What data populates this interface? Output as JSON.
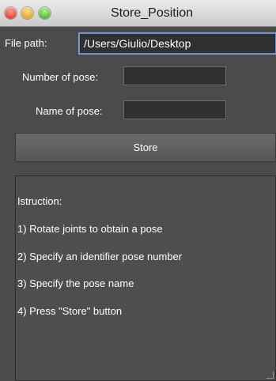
{
  "window": {
    "title": "Store_Position"
  },
  "form": {
    "file_path_label": "File path:",
    "file_path_value": "/Users/Giulio/Desktop",
    "number_label": "Number of pose:",
    "number_value": "",
    "name_label": "Name of pose:",
    "name_value": ""
  },
  "store_button": {
    "label": "Store"
  },
  "instructions": {
    "heading": "Istruction:",
    "steps": [
      "1) Rotate joints to obtain a pose",
      "2) Specify an identifier pose number",
      "3) Specify the pose name",
      "4) Press \"Store\" button"
    ]
  }
}
